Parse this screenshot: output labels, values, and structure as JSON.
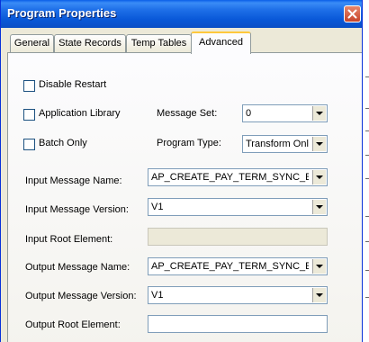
{
  "window": {
    "title": "Program Properties"
  },
  "tabs": [
    {
      "label": "General"
    },
    {
      "label": "State Records"
    },
    {
      "label": "Temp Tables"
    },
    {
      "label": "Advanced",
      "active": true
    }
  ],
  "advanced": {
    "disable_restart": {
      "label": "Disable Restart",
      "checked": false
    },
    "application_library": {
      "label": "Application Library",
      "checked": false
    },
    "batch_only": {
      "label": "Batch Only",
      "checked": false
    },
    "message_set": {
      "label": "Message Set:",
      "value": "0"
    },
    "program_type": {
      "label": "Program Type:",
      "value": "Transform Only"
    },
    "input_message_name": {
      "label": "Input Message Name:",
      "value": "AP_CREATE_PAY_TERM_SYNC_EI"
    },
    "input_message_version": {
      "label": "Input Message Version:",
      "value": "V1"
    },
    "input_root_element": {
      "label": "Input Root Element:",
      "value": ""
    },
    "output_message_name": {
      "label": "Output Message Name:",
      "value": "AP_CREATE_PAY_TERM_SYNC_EI"
    },
    "output_message_version": {
      "label": "Output Message Version:",
      "value": "V1"
    },
    "output_root_element": {
      "label": "Output Root Element:",
      "value": ""
    }
  }
}
